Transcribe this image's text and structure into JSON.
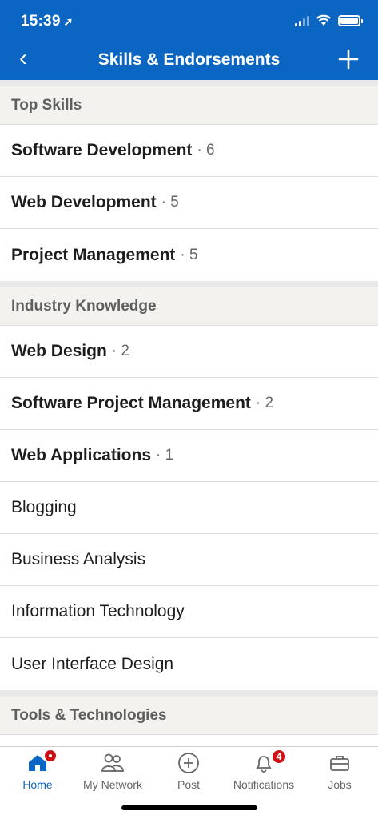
{
  "status_bar": {
    "time": "15:39",
    "location_arrow": "➚"
  },
  "nav": {
    "title": "Skills & Endorsements",
    "back_icon": "‹"
  },
  "sections": [
    {
      "header": "Top Skills",
      "items": [
        {
          "skill": "Software Development",
          "count": "· 6",
          "bold": true
        },
        {
          "skill": "Web Development",
          "count": "· 5",
          "bold": true
        },
        {
          "skill": "Project Management",
          "count": "· 5",
          "bold": true
        }
      ]
    },
    {
      "header": "Industry Knowledge",
      "items": [
        {
          "skill": "Web Design",
          "count": "· 2",
          "bold": true
        },
        {
          "skill": "Software Project Management",
          "count": "· 2",
          "bold": true
        },
        {
          "skill": "Web Applications",
          "count": "· 1",
          "bold": true
        },
        {
          "skill": "Blogging",
          "count": "",
          "bold": false
        },
        {
          "skill": "Business Analysis",
          "count": "",
          "bold": false
        },
        {
          "skill": "Information Technology",
          "count": "",
          "bold": false
        },
        {
          "skill": "User Interface Design",
          "count": "",
          "bold": false
        }
      ]
    },
    {
      "header": "Tools & Technologies",
      "items": []
    }
  ],
  "tabbar": {
    "home": "Home",
    "network": "My Network",
    "post": "Post",
    "notifications": "Notifications",
    "notifications_badge": "4",
    "jobs": "Jobs"
  },
  "colors": {
    "brand": "#0a66c2",
    "badge": "#cc1016"
  }
}
